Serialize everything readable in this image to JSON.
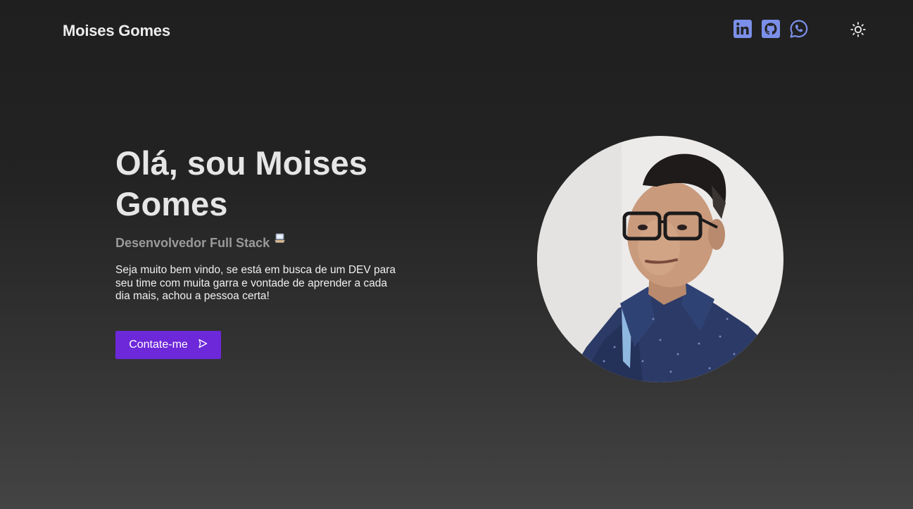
{
  "header": {
    "brand": "Moises Gomes",
    "social": [
      {
        "name": "linkedin",
        "icon": "linkedin-icon",
        "label": "in"
      },
      {
        "name": "github",
        "icon": "github-icon"
      },
      {
        "name": "whatsapp",
        "icon": "whatsapp-icon"
      }
    ],
    "theme_toggle_icon": "sun-icon"
  },
  "hero": {
    "title": "Olá, sou Moises Gomes",
    "subtitle": "Desenvolvedor Full Stack",
    "subtitle_icon": "laptop-icon",
    "description": "Seja muito bem vindo, se está em busca de um DEV para seu time com muita garra e vontade de aprender a cada dia mais, achou a pessoa certa!",
    "cta_label": "Contate-me",
    "cta_icon": "send-icon"
  },
  "colors": {
    "accent": "#6d28d9",
    "social_icon": "#7b8fe8",
    "background_top": "#1f1f1f",
    "background_bottom": "#444444"
  }
}
